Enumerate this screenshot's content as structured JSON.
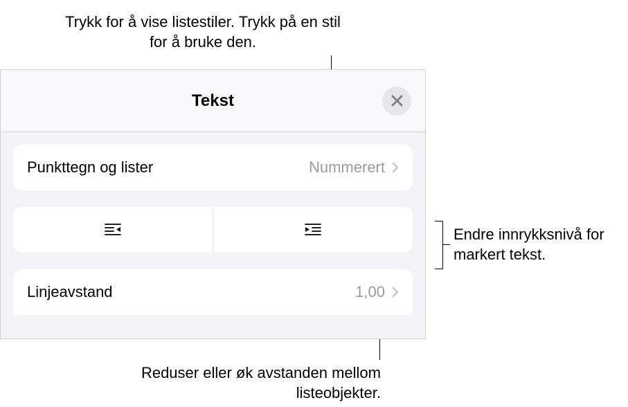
{
  "annotations": {
    "top": "Trykk for å vise listestiler. Trykk på en stil for å bruke den.",
    "right": "Endre innrykksnivå for markert tekst.",
    "bottom": "Reduser eller øk avstanden mellom listeobjekter."
  },
  "panel": {
    "title": "Tekst",
    "bullets_label": "Punkttegn og lister",
    "bullets_value": "Nummerert",
    "spacing_label": "Linjeavstand",
    "spacing_value": "1,00"
  }
}
